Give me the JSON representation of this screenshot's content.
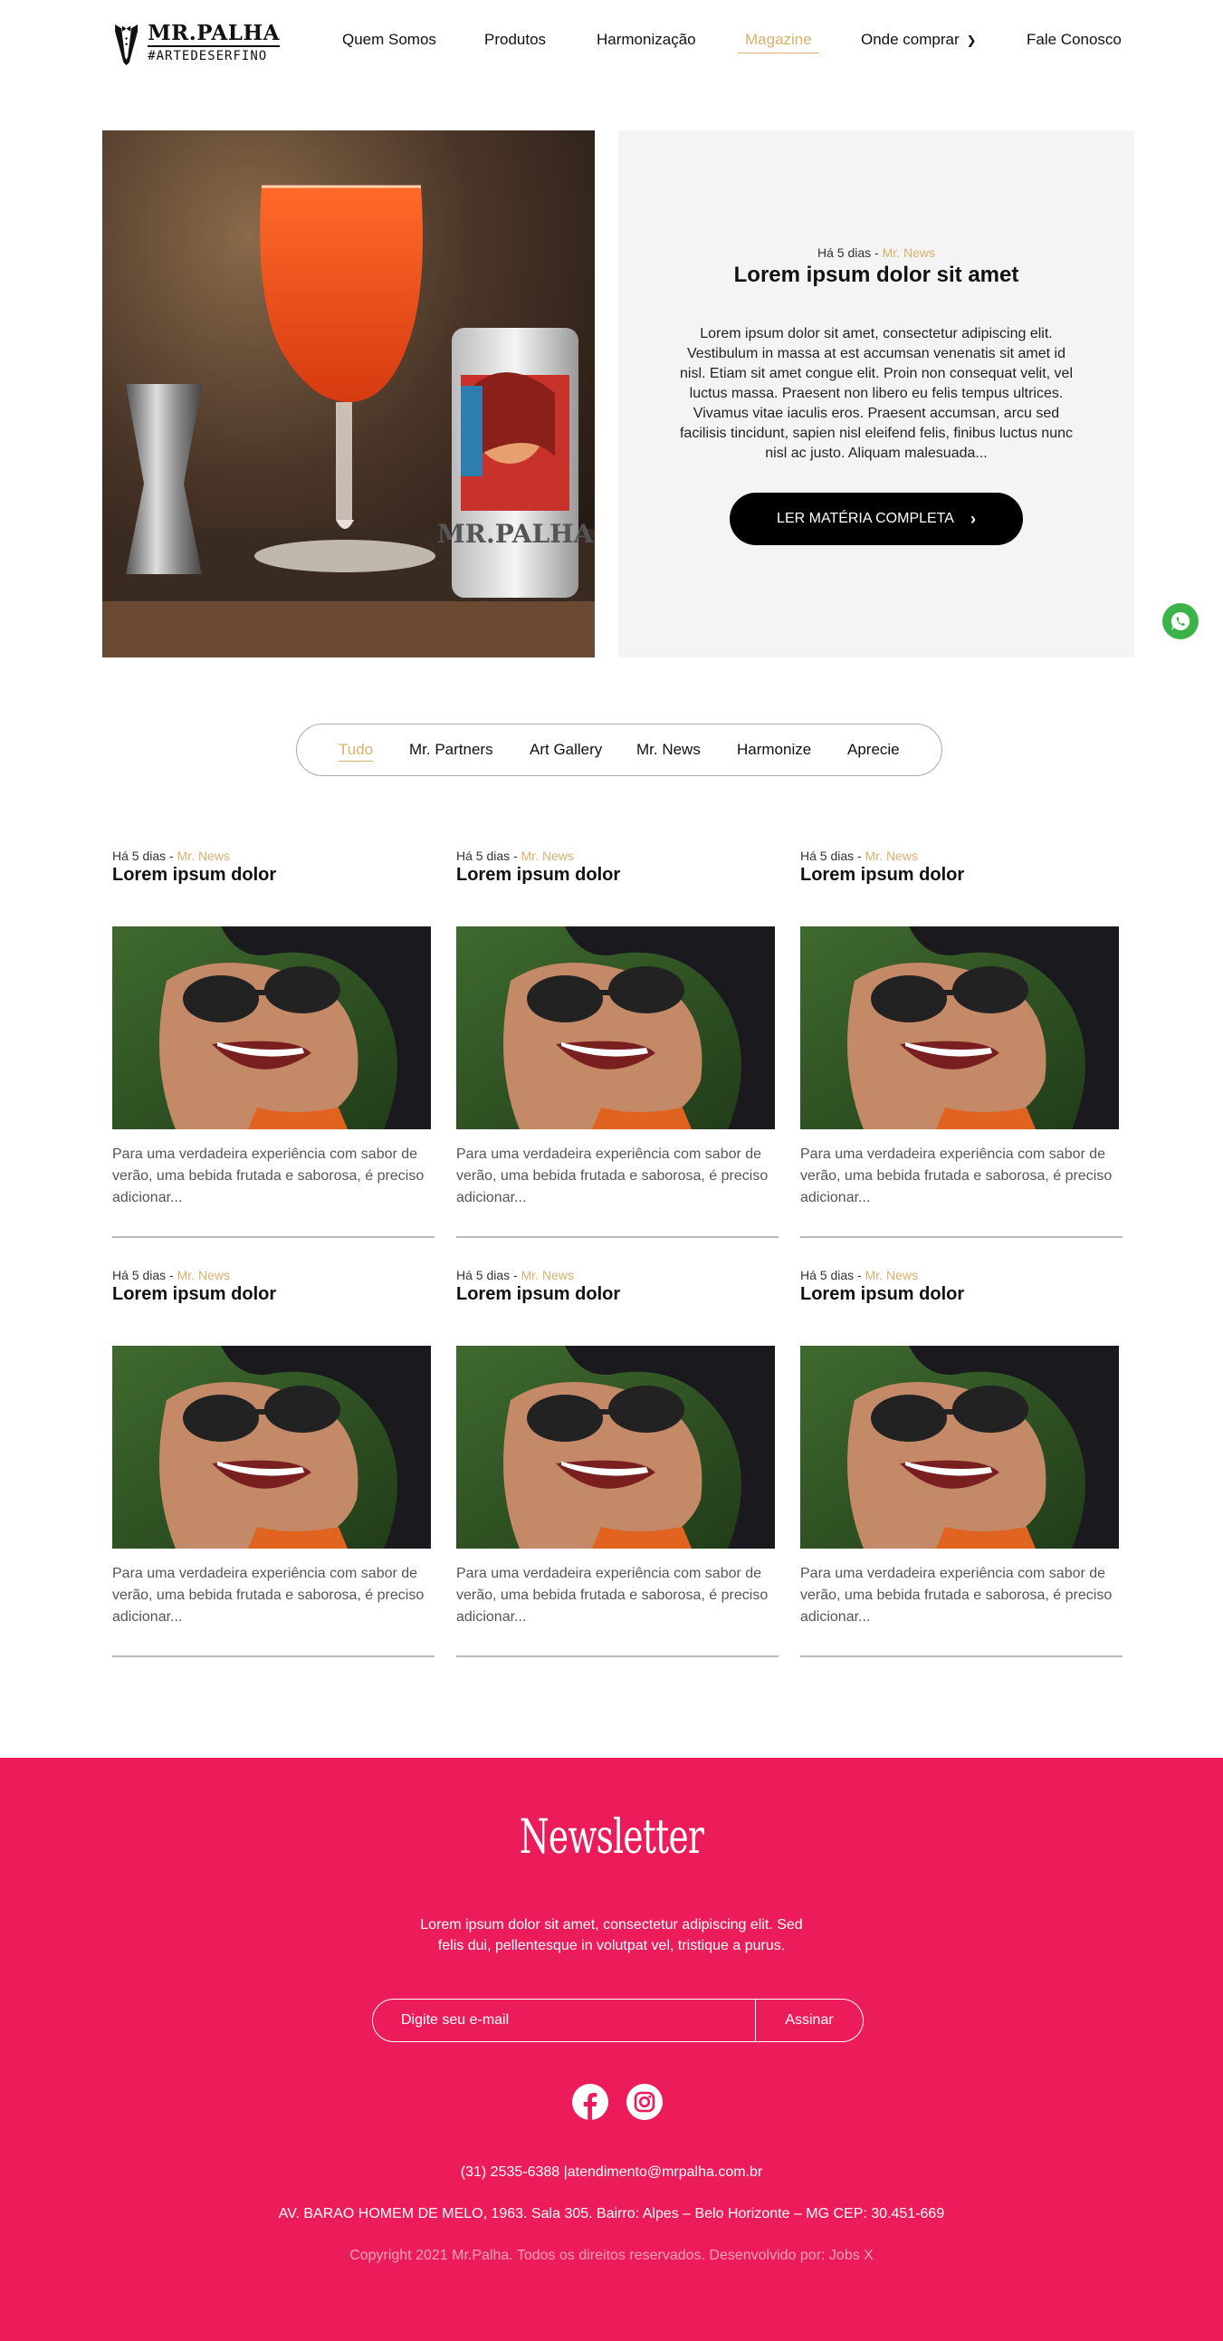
{
  "header": {
    "logo_name": "MR.PALHA",
    "logo_tag": "#ARTEDESERFINO",
    "nav": [
      {
        "label": "Quem Somos"
      },
      {
        "label": "Produtos"
      },
      {
        "label": "Harmonização"
      },
      {
        "label": "Magazine",
        "active": true
      },
      {
        "label": "Onde comprar",
        "dropdown": true
      },
      {
        "label": "Fale Conosco"
      }
    ]
  },
  "hero": {
    "time": "Há 5 dias",
    "separator": " - ",
    "category": "Mr. News",
    "title": "Lorem ipsum dolor sit amet",
    "text": "Lorem ipsum dolor sit amet, consectetur adipiscing elit. Vestibulum in massa at est accumsan venenatis sit amet id nisl. Etiam sit amet congue elit. Proin non consequat velit, vel luctus massa. Praesent non libero eu felis tempus ultrices. Vivamus vitae iaculis eros. Praesent accumsan, arcu sed facilisis tincidunt, sapien nisl eleifend felis, finibus luctus nunc nisl ac justo. Aliquam malesuada...",
    "button_label": "LER MATÉRIA COMPLETA",
    "can_text": "MR.PALHA"
  },
  "filters": [
    {
      "label": "Tudo",
      "active": true
    },
    {
      "label": "Mr. Partners"
    },
    {
      "label": "Art Gallery"
    },
    {
      "label": "Mr. News"
    },
    {
      "label": "Harmonize"
    },
    {
      "label": "Aprecie"
    }
  ],
  "articles": [
    {
      "time": "Há 5 dias",
      "separator": " - ",
      "category": "Mr. News",
      "title": "Lorem ipsum dolor",
      "excerpt": "Para uma verdadeira experiência com sabor de verão, uma bebida frutada e saborosa, é preciso adicionar..."
    },
    {
      "time": "Há 5 dias",
      "separator": " - ",
      "category": "Mr. News",
      "title": "Lorem ipsum dolor",
      "excerpt": "Para uma verdadeira experiência com sabor de verão, uma bebida frutada e saborosa, é preciso adicionar..."
    },
    {
      "time": "Há 5 dias",
      "separator": " - ",
      "category": "Mr. News",
      "title": "Lorem ipsum dolor",
      "excerpt": "Para uma verdadeira experiência com sabor de verão, uma bebida frutada e saborosa, é preciso adicionar..."
    },
    {
      "time": "Há 5 dias",
      "separator": " - ",
      "category": "Mr. News",
      "title": "Lorem ipsum dolor",
      "excerpt": "Para uma verdadeira experiência com sabor de verão, uma bebida frutada e saborosa, é preciso adicionar..."
    },
    {
      "time": "Há 5 dias",
      "separator": " - ",
      "category": "Mr. News",
      "title": "Lorem ipsum dolor",
      "excerpt": "Para uma verdadeira experiência com sabor de verão, uma bebida frutada e saborosa, é preciso adicionar..."
    },
    {
      "time": "Há 5 dias",
      "separator": " - ",
      "category": "Mr. News",
      "title": "Lorem ipsum dolor",
      "excerpt": "Para uma verdadeira experiência com sabor de verão, uma bebida frutada e saborosa, é preciso adicionar..."
    }
  ],
  "newsletter": {
    "title": "Newsletter",
    "text": "Lorem ipsum dolor sit amet, consectetur adipiscing elit. Sed felis dui, pellentesque in volutpat vel, tristique a purus.",
    "placeholder": "Digite seu e-mail",
    "button_label": "Assinar",
    "socials": [
      {
        "icon": "facebook-icon"
      },
      {
        "icon": "instagram-icon"
      }
    ],
    "contact": "(31) 2535-6388 |atendimento@mrpalha.com.br",
    "address": "AV. BARAO HOMEM DE MELO, 1963. Sala 305. Bairro: Alpes – Belo Horizonte – MG CEP: 30.451-669",
    "copyright": "Copyright 2021 Mr.Palha. Todos os direitos reservados. Desenvolvido por: Jobs X"
  },
  "colors": {
    "accent": "#d9b06b",
    "newsletter_bg": "#ec1c5a",
    "button_bg": "#000000",
    "whatsapp": "#3cb349"
  }
}
